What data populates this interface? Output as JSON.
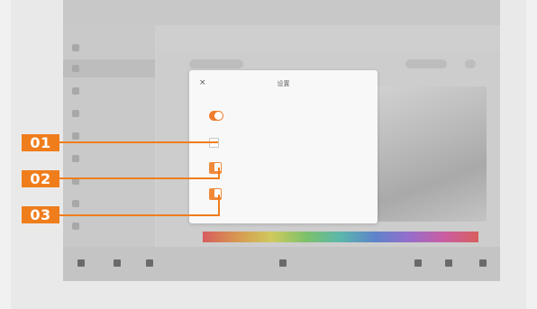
{
  "statusbar": {
    "left_text": "",
    "right_text": ""
  },
  "tabs": [
    {
      "label": ""
    },
    {
      "label": ""
    }
  ],
  "sidebar": {
    "items": [
      {
        "label": ""
      },
      {
        "label": ""
      },
      {
        "label": ""
      },
      {
        "label": ""
      },
      {
        "label": ""
      },
      {
        "label": ""
      },
      {
        "label": ""
      },
      {
        "label": ""
      },
      {
        "label": ""
      }
    ]
  },
  "dialog": {
    "close_glyph": "×",
    "title": "设置",
    "rows": [
      {
        "title": "",
        "subtitle": "",
        "control": "toggle",
        "state": "on"
      },
      {
        "title": "",
        "subtitle": "",
        "control": "checkbox",
        "state": "off"
      },
      {
        "title": "",
        "subtitle": "",
        "control": "checkbox",
        "state": "on"
      },
      {
        "title": "",
        "subtitle": "",
        "control": "checkbox",
        "state": "on"
      }
    ]
  },
  "callouts": [
    {
      "label": "01"
    },
    {
      "label": "02"
    },
    {
      "label": "03"
    }
  ],
  "bottombar": {
    "zoom": "",
    "page": ""
  },
  "colors": {
    "accent": "#f07d1c",
    "toggle_on": "#f07d2e",
    "dialog_bg": "#f8f8f8",
    "screen_bg": "#cfcfcf"
  },
  "icons": [
    "close-icon",
    "toggle-switch-icon",
    "checkbox-icon",
    "color-spectrum-bar"
  ]
}
